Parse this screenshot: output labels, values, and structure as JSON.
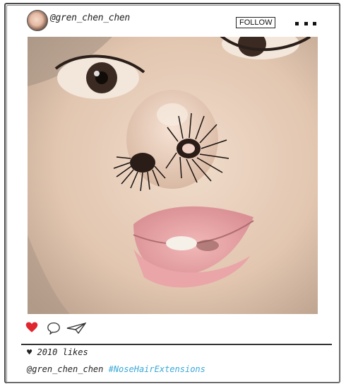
{
  "post": {
    "username": "@gren_chen_chen",
    "follow_label": "FOLLOW",
    "likes_text": "2010 likes",
    "caption_user": "@gren_chen_chen",
    "hashtag": "#NoseHairExtensions"
  },
  "icons": {
    "like": "heart-icon",
    "comment": "speech-bubble-icon",
    "share": "paper-plane-icon",
    "more": "more-options-icon"
  },
  "colors": {
    "heart": "#e0262f",
    "hashtag": "#39a8d8"
  }
}
